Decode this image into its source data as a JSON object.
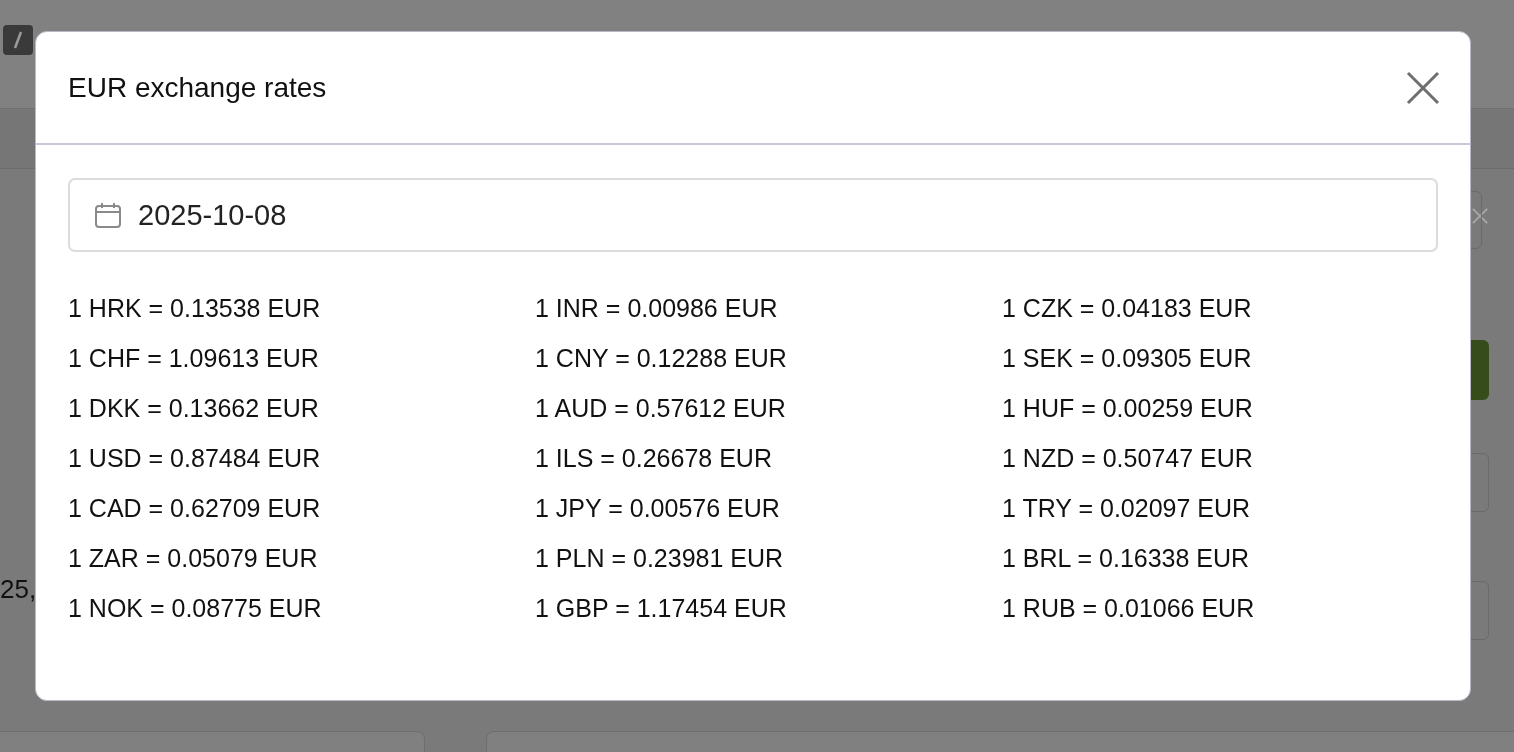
{
  "background": {
    "partial_text": "25,"
  },
  "dialog": {
    "title": "EUR exchange rates",
    "date_field": {
      "value": "2025-10-08"
    },
    "rates": [
      "1 HRK = 0.13538 EUR",
      "1 INR = 0.00986 EUR",
      "1 CZK = 0.04183 EUR",
      "1 CHF = 1.09613 EUR",
      "1 CNY = 0.12288 EUR",
      "1 SEK = 0.09305 EUR",
      "1 DKK = 0.13662 EUR",
      "1 AUD = 0.57612 EUR",
      "1 HUF = 0.00259 EUR",
      "1 USD = 0.87484 EUR",
      "1 ILS = 0.26678 EUR",
      "1 NZD = 0.50747 EUR",
      "1 CAD = 0.62709 EUR",
      "1 JPY = 0.00576 EUR",
      "1 TRY = 0.02097 EUR",
      "1 ZAR = 0.05079 EUR",
      "1 PLN = 0.23981 EUR",
      "1 BRL = 0.16338 EUR",
      "1 NOK = 0.08775 EUR",
      "1 GBP = 1.17454 EUR",
      "1 RUB = 0.01066 EUR"
    ]
  }
}
